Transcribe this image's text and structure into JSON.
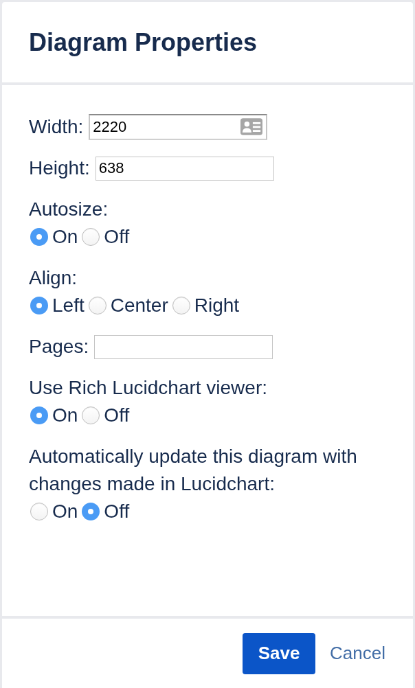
{
  "dialog": {
    "title": "Diagram Properties"
  },
  "fields": [
    {
      "kind": "text",
      "label": "Width:",
      "value": "2220",
      "autofill": true
    },
    {
      "kind": "text",
      "label": "Height:",
      "value": "638",
      "autofill": false
    },
    {
      "kind": "radio",
      "label": "Autosize:",
      "options": [
        {
          "label": "On",
          "selected": true
        },
        {
          "label": "Off",
          "selected": false
        }
      ]
    },
    {
      "kind": "radio",
      "label": "Align:",
      "options": [
        {
          "label": "Left",
          "selected": true
        },
        {
          "label": "Center",
          "selected": false
        },
        {
          "label": "Right",
          "selected": false
        }
      ]
    },
    {
      "kind": "text",
      "label": "Pages:",
      "autofill": false
    },
    {
      "kind": "radio",
      "label": "Use Rich Lucidchart viewer:",
      "options": [
        {
          "label": "On",
          "selected": true
        },
        {
          "label": "Off",
          "selected": false
        }
      ]
    },
    {
      "kind": "radio",
      "label": "Automatically update this diagram with changes made in Lucidchart:",
      "options": [
        {
          "label": "On",
          "selected": false
        },
        {
          "label": "Off",
          "selected": true
        }
      ]
    }
  ],
  "footer": {
    "buttons": [
      {
        "kind": "primary",
        "label": "Save"
      },
      {
        "kind": "link",
        "label": "Cancel"
      }
    ]
  }
}
